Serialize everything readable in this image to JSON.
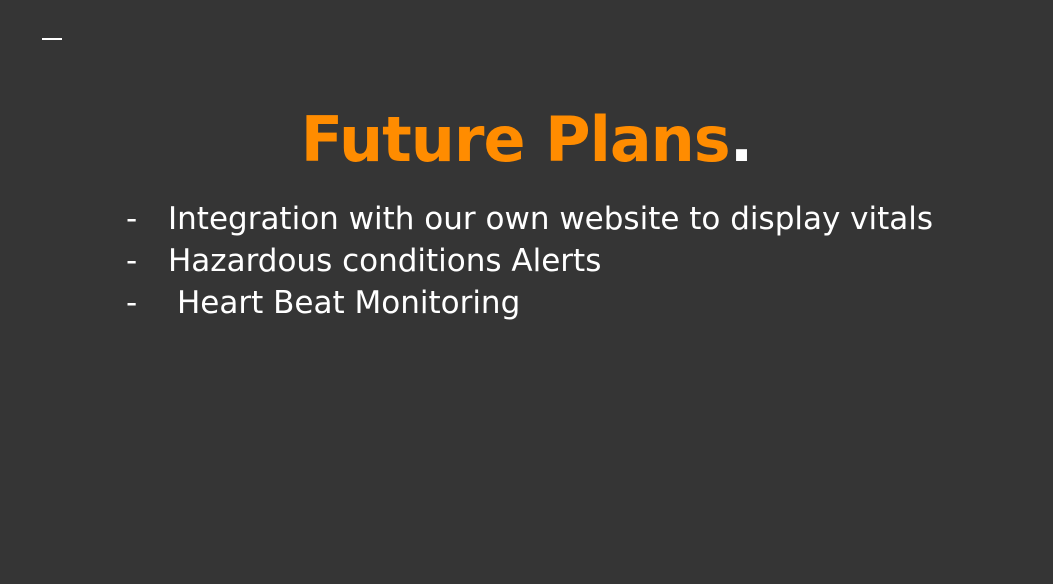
{
  "slide": {
    "title": "Future Plans",
    "title_suffix": ".",
    "bullets": [
      {
        "marker": "-",
        "text": "Integration with our own website to display vitals"
      },
      {
        "marker": "-",
        "text": "Hazardous conditions Alerts"
      },
      {
        "marker": "-",
        "text": "Heart Beat Monitoring"
      }
    ]
  },
  "colors": {
    "background": "#353535",
    "accent": "#ff8c00",
    "text": "#ffffff"
  }
}
